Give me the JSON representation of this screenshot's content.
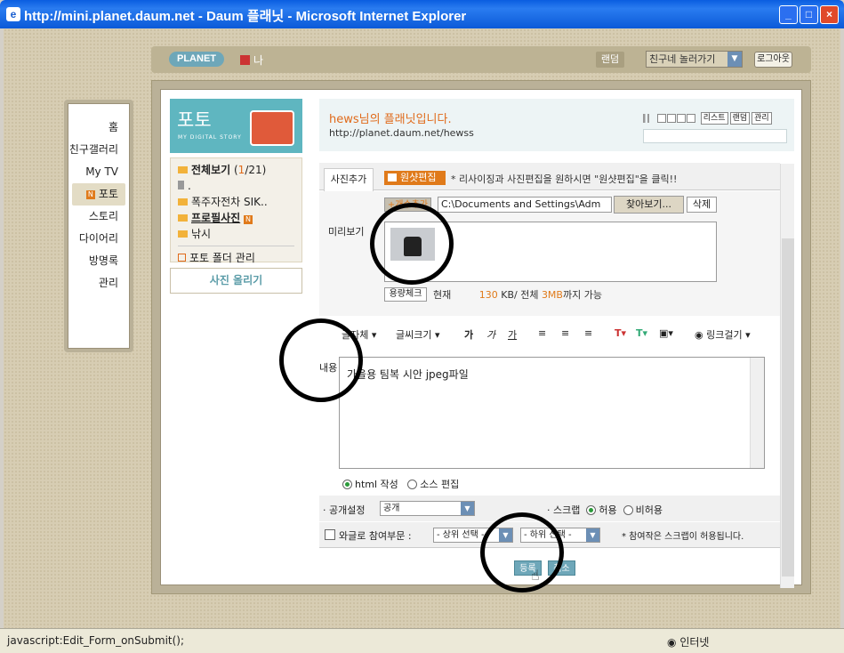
{
  "window": {
    "title": "http://mini.planet.daum.net - Daum 플래닛 - Microsoft Internet Explorer",
    "buttons": [
      "_",
      "□",
      "×"
    ]
  },
  "topbar": {
    "logo": "PLANET",
    "me": "나",
    "random": "랜덤",
    "friend_select": "친구네 놀러가기",
    "logout": "로그아웃"
  },
  "nav": {
    "items": [
      "홈",
      "친구갤러리",
      "My TV",
      "포토",
      "스토리",
      "다이어리",
      "방명록",
      "관리"
    ],
    "active_badge": "N"
  },
  "photo": {
    "title": "포토",
    "subtitle": "MY DIGITAL STORY",
    "folders": [
      {
        "label": "전체보기",
        "count_current": "1",
        "count_total": "/21"
      },
      {
        "label": "."
      },
      {
        "label": "폭주자전차 SIK.."
      },
      {
        "label": "프로필사진",
        "badge": "N"
      },
      {
        "label": "낚시"
      }
    ],
    "manage": "포토 폴더 관리",
    "upload": "사진 올리기"
  },
  "greeting": {
    "line1": "hews님의 플래닛입니다.",
    "line2": "http://planet.daum.net/hewss",
    "player_buttons": [
      "리스트",
      "랜덤",
      "관리"
    ]
  },
  "form": {
    "tab": "사진추가",
    "orig_edit": "원샷편집",
    "hint": "* 리사이징과 사진편집을 원하시면 \"원샷편집\"을 클릭!!",
    "add_file": "+개수추가",
    "file_path": "C:\\Documents and Settings\\Adm",
    "browse": "찾아보기...",
    "delete": "삭제",
    "preview_label": "미리보기",
    "capacity_button": "용량체크",
    "capacity_prefix": "현재",
    "capacity_current": "130",
    "capacity_mid": "KB/ 전체",
    "capacity_total": "3MB",
    "capacity_suffix": "까지 가능",
    "toolbar": {
      "font": "글자체",
      "size": "글씨크기",
      "bold": "가",
      "italic": "가",
      "underline": "가",
      "link": "링크걸기"
    },
    "content_label": "내용",
    "content_text": "가을용 팀복 시안 jpeg파일",
    "mode_html": "html 작성",
    "mode_source": "소스 편집",
    "visibility_label": "· 공개설정",
    "visibility_value": "공개",
    "scrap_label": "· 스크랩",
    "scrap_allow": "허용",
    "scrap_deny": "비허용",
    "wag_label": "와글로  참여부문 :",
    "wag_upper": "- 상위 선택 -",
    "wag_lower": "- 하위 선택 -",
    "wag_note": "* 참여작은 스크랩이 허용됩니다.",
    "submit": "등록",
    "cancel": "취소"
  },
  "status": {
    "left": "javascript:Edit_Form_onSubmit();",
    "zone": "인터넷"
  }
}
